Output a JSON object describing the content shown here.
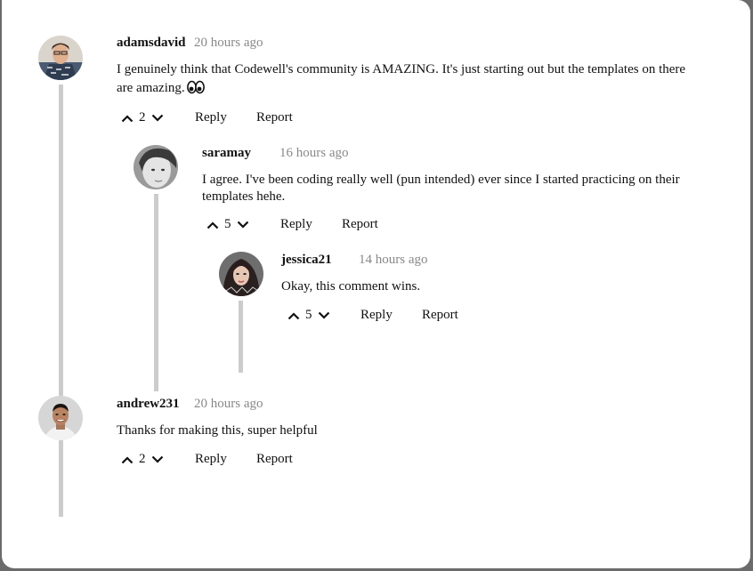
{
  "comments": [
    {
      "username": "adamsdavid",
      "time": "20 hours ago",
      "text": "I genuinely think that Codewell's community is AMAZING. It's just starting out but the templates on there are amazing.",
      "emoji": "eyes-emoji",
      "votes": "2",
      "reply_label": "Reply",
      "report_label": "Report",
      "avatar": "avatar-adamsdavid"
    },
    {
      "username": "saramay",
      "time": "16 hours ago",
      "text": "I agree. I've been coding really well (pun intended) ever since I started practicing on their templates hehe.",
      "votes": "5",
      "reply_label": "Reply",
      "report_label": "Report",
      "avatar": "avatar-saramay"
    },
    {
      "username": "jessica21",
      "time": "14 hours ago",
      "text": "Okay, this comment wins.",
      "votes": "5",
      "reply_label": "Reply",
      "report_label": "Report",
      "avatar": "avatar-jessica21"
    },
    {
      "username": "andrew231",
      "time": "20 hours ago",
      "text": "Thanks for making this, super helpful",
      "votes": "2",
      "reply_label": "Reply",
      "report_label": "Report",
      "avatar": "avatar-andrew231"
    }
  ],
  "colors": {
    "thread_line": "#cccccc",
    "timestamp": "#888888",
    "background": "#ffffff"
  }
}
